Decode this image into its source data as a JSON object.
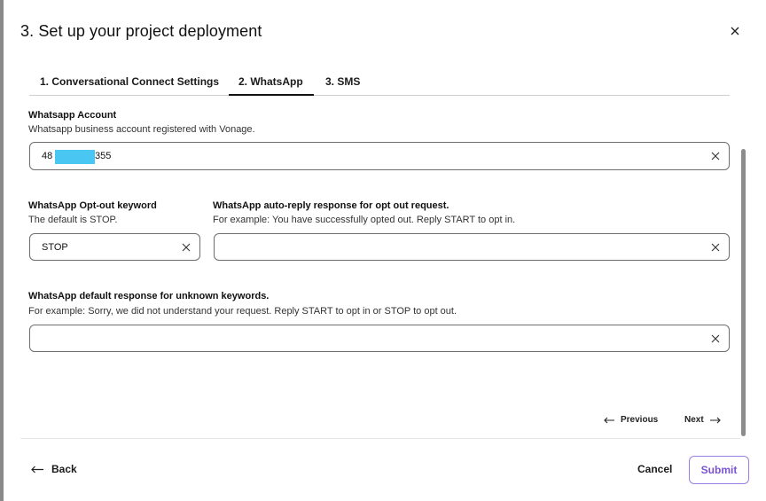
{
  "modal": {
    "title": "3. Set up your project deployment"
  },
  "tabs": [
    {
      "label": "1. Conversational Connect Settings",
      "active": false
    },
    {
      "label": "2. WhatsApp",
      "active": true
    },
    {
      "label": "3. SMS",
      "active": false
    }
  ],
  "whatsapp_account": {
    "label": "Whatsapp Account",
    "help": "Whatsapp business account registered with Vonage.",
    "value_prefix": "48",
    "value_suffix": "355"
  },
  "optout_keyword": {
    "label": "WhatsApp Opt-out keyword",
    "help": "The default is STOP.",
    "value": "STOP"
  },
  "optout_reply": {
    "label": "WhatsApp auto-reply response for opt out request.",
    "help": "For example: You have successfully opted out. Reply START to opt in.",
    "value": ""
  },
  "unknown_keywords": {
    "label": "WhatsApp default response for unknown keywords.",
    "help": "For example: Sorry, we did not understand your request. Reply START to opt in or STOP to opt out.",
    "value": ""
  },
  "pager": {
    "previous_label": "Previous",
    "next_label": "Next"
  },
  "footer": {
    "back_label": "Back",
    "cancel_label": "Cancel",
    "submit_label": "Submit"
  },
  "colors": {
    "accent": "#7a52d6",
    "redaction": "#49c6f1"
  }
}
